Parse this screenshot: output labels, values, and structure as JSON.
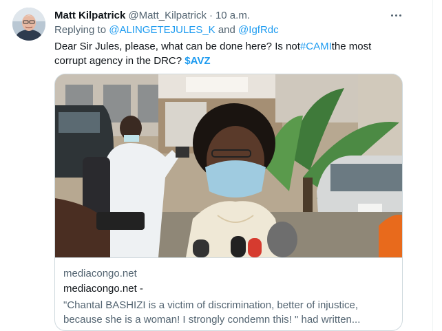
{
  "tweet": {
    "author_name": "Matt Kilpatrick",
    "handle": "@Matt_Kilpatrick",
    "separator": "·",
    "time": "10 a.m.",
    "replying_prefix": "Replying to ",
    "reply_to_1": "@ALINGETEJULES_K",
    "reply_and": " and ",
    "reply_to_2": "@IgfRdc",
    "text_part1": "Dear Sir Jules, please, what can be done here? Is not",
    "hashtag": "#CAMI",
    "text_part2": "the most corrupt agency in the DRC? ",
    "cashtag": "$AVZ"
  },
  "card": {
    "domain": "mediacongo.net",
    "title": "mediacongo.net -",
    "description": "\"Chantal BASHIZI is a victim of discrimination, better of injustice, because she is a woman! I strongly condemn this! \" had written..."
  },
  "icons": {
    "more": "more-horizontal-icon"
  },
  "colors": {
    "accent": "#1d9bf0",
    "secondary_text": "#536471",
    "primary_text": "#0f1419",
    "border": "#cfd9de"
  }
}
